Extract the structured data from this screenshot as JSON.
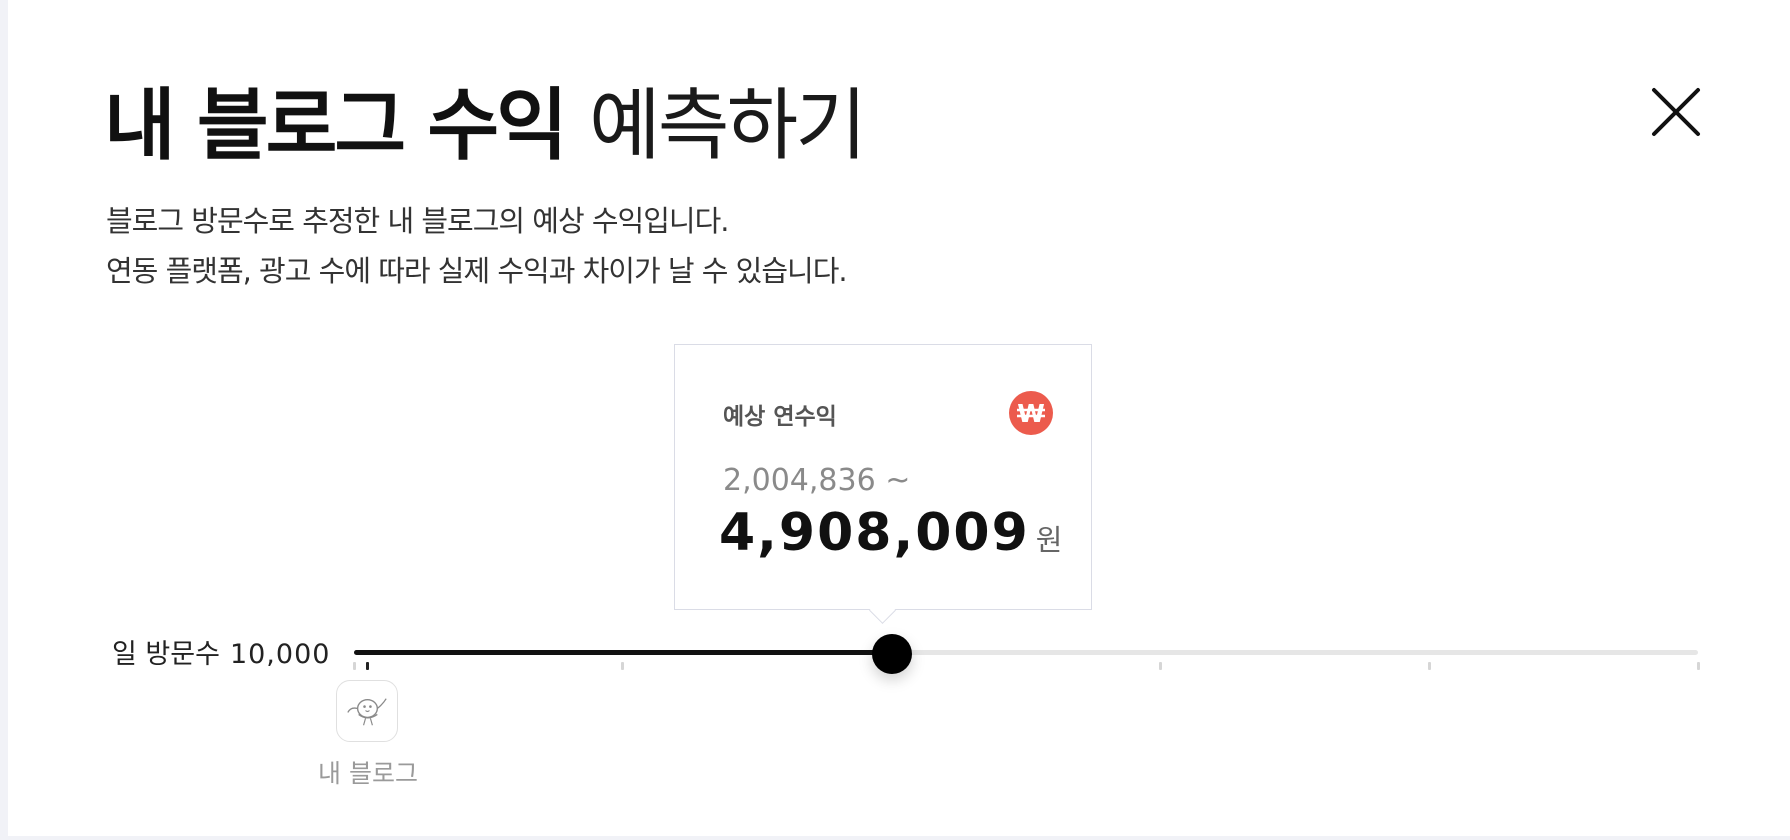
{
  "modal": {
    "title_bold": "내 블로그 수익",
    "title_light": "예측하기",
    "description": [
      "블로그 방문수로 추정한 내 블로그의 예상 수익입니다.",
      "연동 플랫폼, 광고 수에 따라 실제 수익과 차이가 날 수 있습니다."
    ],
    "close_icon": "close-icon"
  },
  "estimate": {
    "label": "예상 연수익",
    "currency_icon": "won-icon",
    "currency_icon_color": "#ec5b4d",
    "range_low": "2,004,836 ~",
    "range_high": "4,908,009",
    "unit": "원"
  },
  "slider": {
    "label": "일 방문수",
    "value": "10,000",
    "fill_fraction": 0.4,
    "tick_fractions": [
      0,
      0.2,
      0.6,
      0.8,
      1.0
    ],
    "my_blog_fraction": 0.01
  },
  "my_blog": {
    "label": "내 블로그",
    "icon": "bird-icon"
  },
  "colors": {
    "accent": "#111111",
    "won_badge": "#ec5b4d",
    "track": "#e6e6e6"
  }
}
